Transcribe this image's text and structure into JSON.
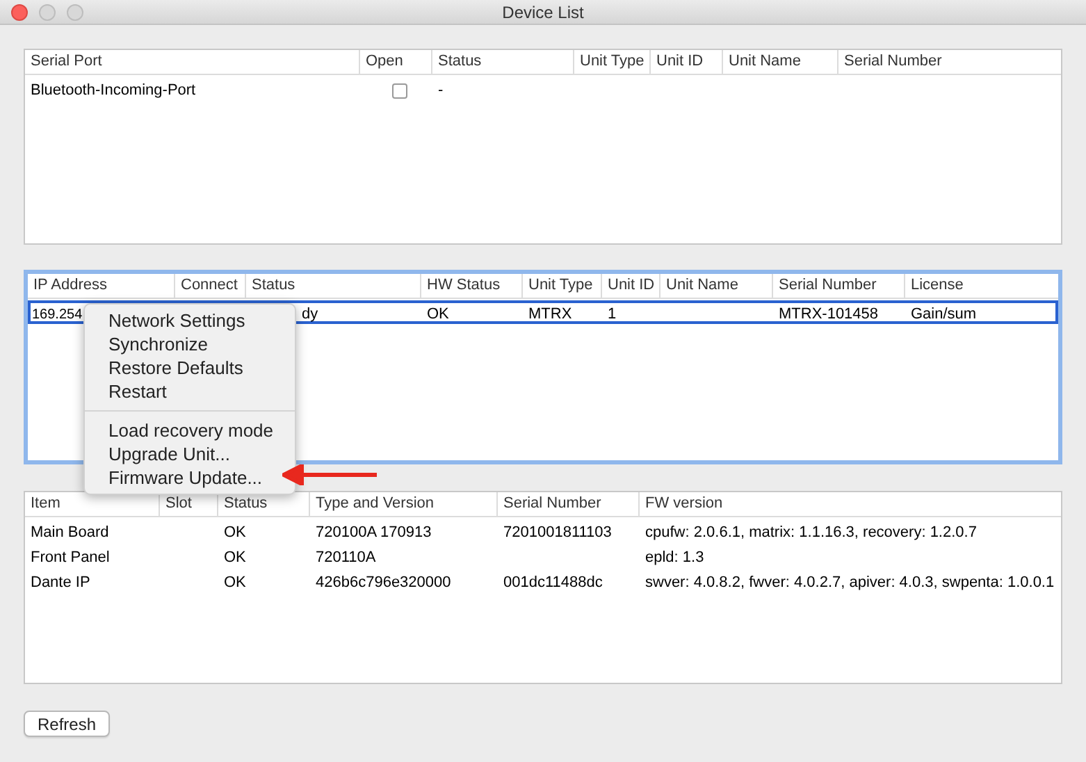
{
  "window": {
    "title": "Device List"
  },
  "serial_table": {
    "columns": [
      "Serial Port",
      "Open",
      "Status",
      "Unit Type",
      "Unit ID",
      "Unit Name",
      "Serial Number"
    ],
    "rows": [
      {
        "selected": false,
        "serial_port": "Bluetooth-Incoming-Port",
        "open": false,
        "status": "-"
      }
    ]
  },
  "network_table": {
    "focused": true,
    "columns": [
      "IP Address",
      "Connect",
      "Status",
      "HW Status",
      "Unit Type",
      "Unit ID",
      "Unit Name",
      "Serial Number",
      "License"
    ],
    "rows": [
      {
        "selected": true,
        "ip_address": "169.254",
        "status": "dy",
        "hw_status": "OK",
        "unit_type": "MTRX",
        "unit_id": "1",
        "serial_number": "MTRX-101458",
        "license": "Gain/sum"
      }
    ]
  },
  "context_menu": {
    "groups": [
      [
        "Network Settings",
        "Synchronize",
        "Restore Defaults",
        "Restart"
      ],
      [
        "Load recovery mode",
        "Upgrade Unit...",
        "Firmware Update..."
      ]
    ]
  },
  "module_table": {
    "columns": [
      "Item",
      "Slot",
      "Status",
      "Type and Version",
      "Serial Number",
      "FW version"
    ],
    "rows": [
      {
        "selected": false,
        "item": "Main Board",
        "status": "OK",
        "type_and_version": "720100A   170913",
        "serial_number": "7201001811103",
        "fw_version": "cpufw: 2.0.6.1, matrix: 1.1.16.3, recovery: 1.2.0.7"
      },
      {
        "selected": false,
        "item": "Front Panel",
        "status": "OK",
        "type_and_version": "720110A",
        "fw_version": "epld: 1.3"
      },
      {
        "selected": false,
        "item": "Dante IP",
        "status": "OK",
        "type_and_version": "426b6c796e320000",
        "serial_number": "001dc11488dc",
        "fw_version": "swver: 4.0.8.2, fwver: 4.0.2.7, apiver: 4.0.3, swpenta: 1.0.0.1"
      }
    ]
  },
  "buttons": [
    {
      "label": "Refresh"
    }
  ]
}
